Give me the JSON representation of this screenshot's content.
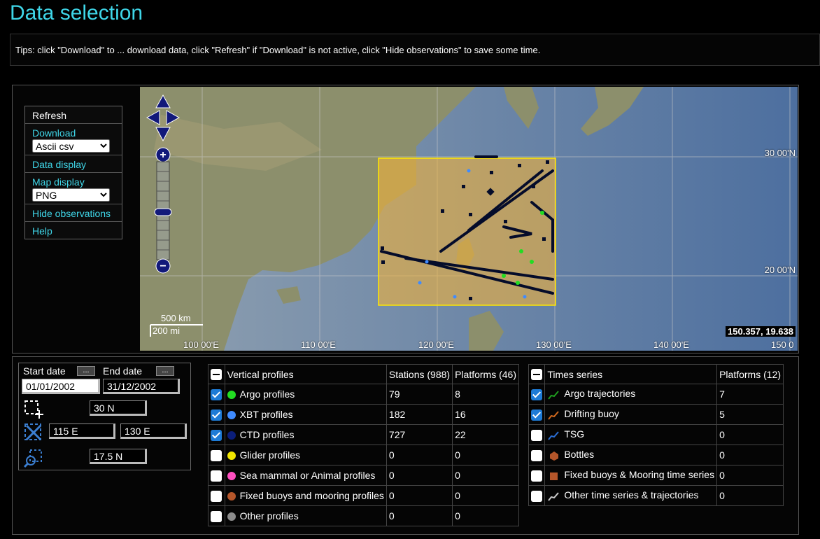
{
  "page": {
    "title": "Data selection"
  },
  "tips": "Tips: click \"Download\" to ... download data, click \"Refresh\" if \"Download\" is not active, click \"Hide observations\" to save some time.",
  "menu": {
    "refresh": "Refresh",
    "download": "Download",
    "download_format": "Ascii csv",
    "data_display": "Data display",
    "map_display": "Map display",
    "map_format": "PNG",
    "hide_observations": "Hide observations",
    "help": "Help"
  },
  "map": {
    "coord_readout": "150.357, 19.638",
    "lat_labels": [
      "30 00'N",
      "20 00'N"
    ],
    "lon_labels": [
      "100 00'E",
      "110 00'E",
      "120 00'E",
      "130 00'E",
      "140 00'E",
      "150 0"
    ],
    "scale_km": "500 km",
    "scale_mi": "200 mi"
  },
  "dates": {
    "start_label": "Start date",
    "end_label": "End date",
    "picker_label": "...",
    "start_value": "01/01/2002",
    "end_value": "31/12/2002",
    "north": "30 N",
    "west": "115 E",
    "east": "130 E",
    "south": "17.5 N"
  },
  "vertical": {
    "header": "Vertical profiles",
    "stations_header": "Stations (988)",
    "platforms_header": "Platforms (46)",
    "rows": [
      {
        "label": "Argo profiles",
        "stations": "79",
        "platforms": "8",
        "checked": true,
        "color": "#22dd22"
      },
      {
        "label": "XBT profiles",
        "stations": "182",
        "platforms": "16",
        "checked": true,
        "color": "#3f8bff"
      },
      {
        "label": "CTD profiles",
        "stations": "727",
        "platforms": "22",
        "checked": true,
        "color": "#0b1e7a"
      },
      {
        "label": "Glider profiles",
        "stations": "0",
        "platforms": "0",
        "checked": false,
        "color": "#f2e600"
      },
      {
        "label": "Sea mammal or Animal profiles",
        "stations": "0",
        "platforms": "0",
        "checked": false,
        "color": "#ff4fc0"
      },
      {
        "label": "Fixed buoys and mooring profiles",
        "stations": "0",
        "platforms": "0",
        "checked": false,
        "color": "#b5562a"
      },
      {
        "label": "Other profiles",
        "stations": "0",
        "platforms": "0",
        "checked": false,
        "color": "#8c8c8c"
      }
    ]
  },
  "timeseries": {
    "header": "Times series",
    "platforms_header": "Platforms (12)",
    "rows": [
      {
        "label": "Argo trajectories",
        "platforms": "7",
        "checked": true,
        "icon": "argo-trajectory-icon",
        "color": "#1f9e1f"
      },
      {
        "label": "Drifting buoy",
        "platforms": "5",
        "checked": true,
        "icon": "drifting-buoy-icon",
        "color": "#d2691e"
      },
      {
        "label": "TSG",
        "platforms": "0",
        "checked": false,
        "icon": "tsg-icon",
        "color": "#2b6fd6"
      },
      {
        "label": "Bottles",
        "platforms": "0",
        "checked": false,
        "icon": "bottle-icon",
        "color": "#b5562a"
      },
      {
        "label": "Fixed buoys & Mooring time series",
        "platforms": "0",
        "checked": false,
        "icon": "mooring-icon",
        "color": "#b5562a"
      },
      {
        "label": "Other time series & trajectories",
        "platforms": "0",
        "checked": false,
        "icon": "other-trajectory-icon",
        "color": "#cccccc"
      }
    ]
  }
}
